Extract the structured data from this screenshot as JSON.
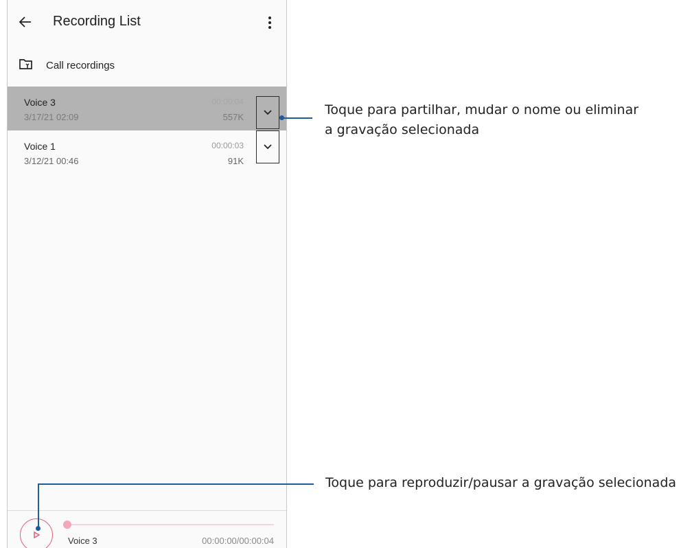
{
  "appbar": {
    "title": "Recording List",
    "back_icon": "arrow-left-icon",
    "more_icon": "more-vertical-icon"
  },
  "call_recordings": {
    "label": "Call recordings",
    "icon": "folder-call-icon"
  },
  "recordings": [
    {
      "name": "Voice 3",
      "date": "3/17/21 02:09",
      "duration": "00:00:04",
      "size": "557K",
      "selected": true
    },
    {
      "name": "Voice 1",
      "date": "3/12/21 00:46",
      "duration": "00:00:03",
      "size": "91K",
      "selected": false
    }
  ],
  "player": {
    "track_name": "Voice 3",
    "time": "00:00:00/00:00:04",
    "progress": 0
  },
  "callouts": {
    "expand_line1": "Toque para partilhar, mudar o nome ou eliminar",
    "expand_line2": "a gravação selecionada",
    "play": "Toque para reproduzir/pausar a gravação selecionada"
  },
  "colors": {
    "accent": "#e0607e",
    "selected_row": "#b3b3b3",
    "callout": "#1d5b9a"
  }
}
